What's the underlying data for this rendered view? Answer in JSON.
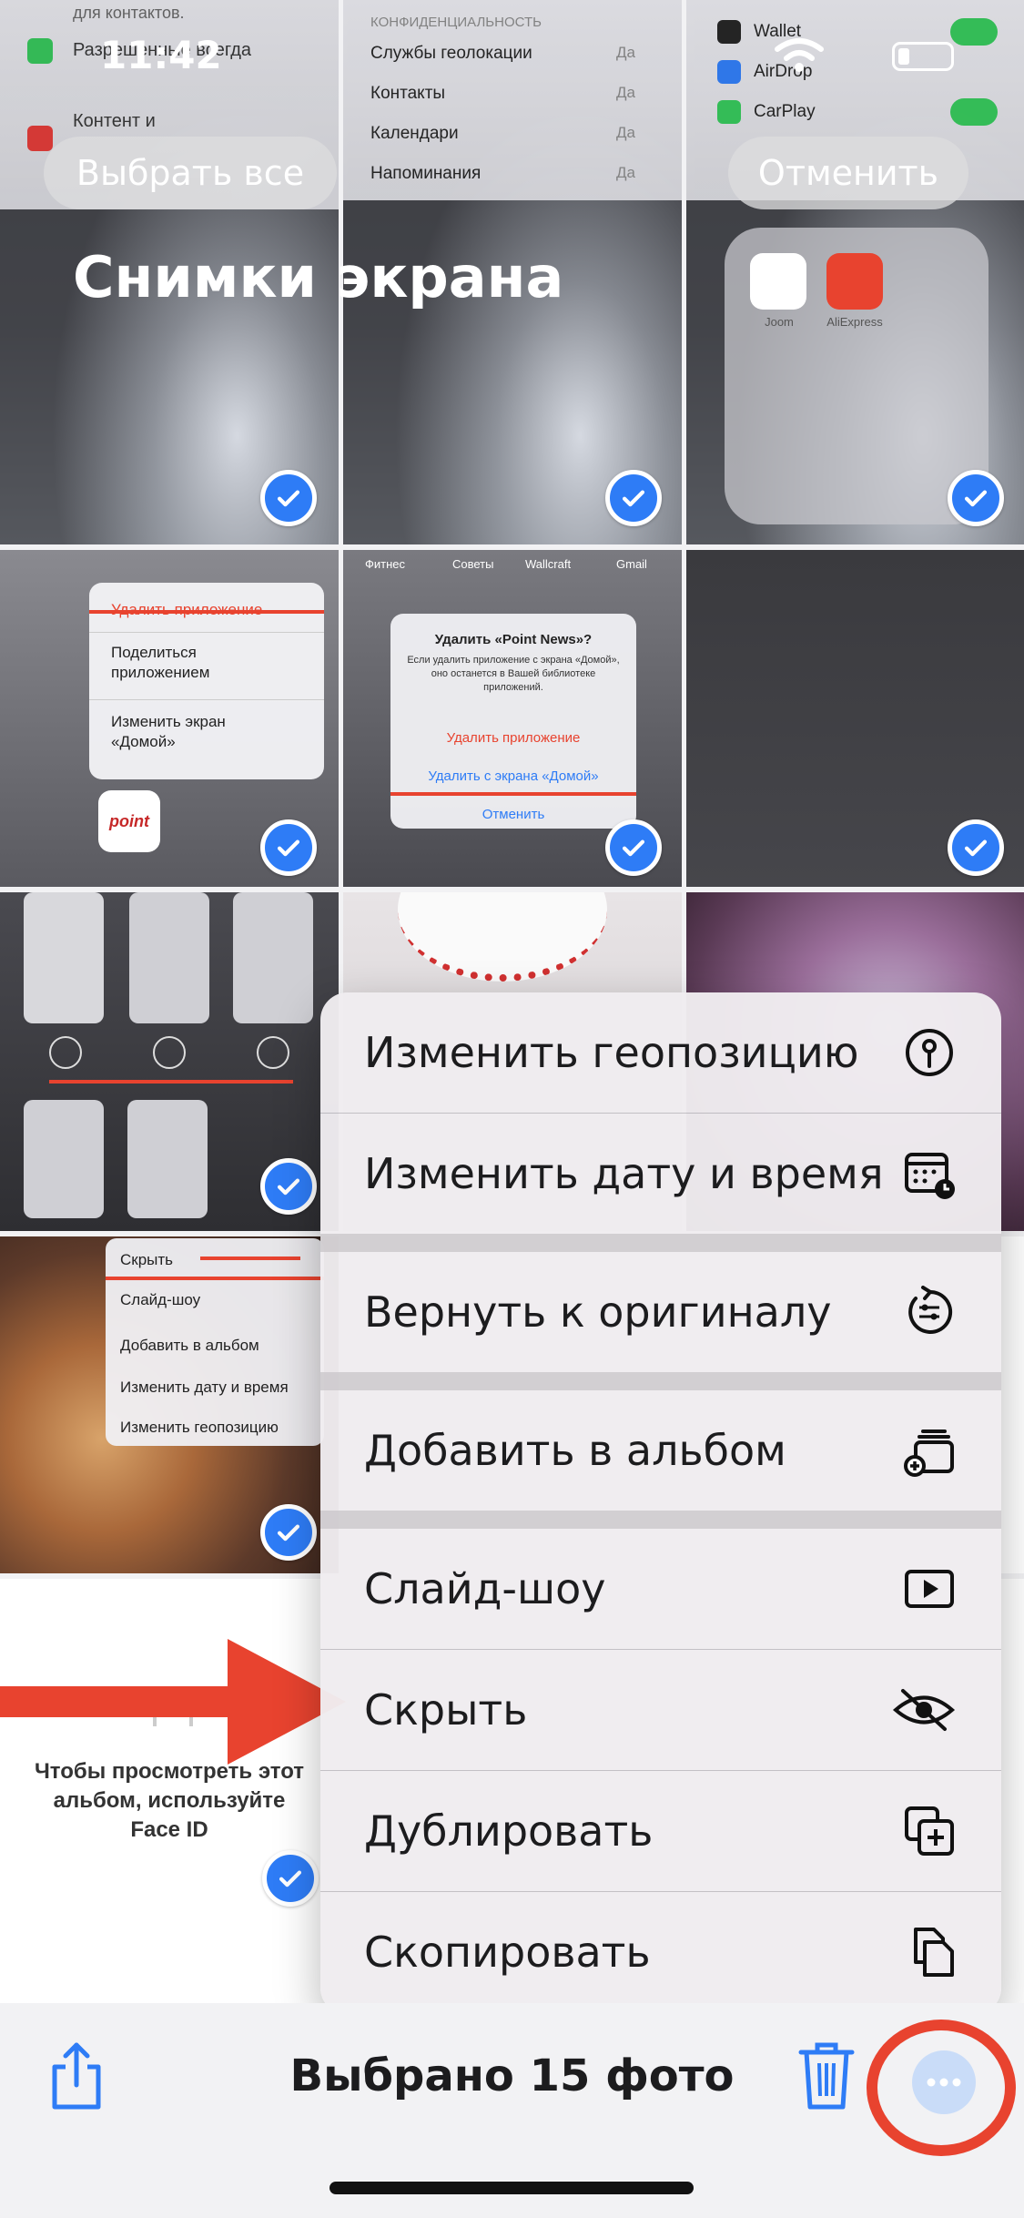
{
  "status_bar": {
    "time": "11:42"
  },
  "header": {
    "select_all_label": "Выбрать все",
    "cancel_label": "Отменить",
    "album_title": "Снимки экрана"
  },
  "thumbnails": {
    "settings_top_left": {
      "lines": [
        "для контактов.",
        "Разрешенные всегда",
        "Контент и"
      ]
    },
    "settings_top_mid": {
      "section": "КОНФИДЕНЦИАЛЬНОСТЬ",
      "rows": [
        {
          "label": "Службы геолокации",
          "value": "Да"
        },
        {
          "label": "Контакты",
          "value": "Да"
        },
        {
          "label": "Календари",
          "value": "Да"
        },
        {
          "label": "Напоминания",
          "value": "Да"
        }
      ]
    },
    "settings_top_right": {
      "rows": [
        "Wallet",
        "AirDrop",
        "CarPlay"
      ]
    },
    "folder_apps": [
      "Joom",
      "AliExpress"
    ],
    "app_menu": [
      "Удалить приложение",
      "Поделиться приложением",
      "Изменить экран «Домой»"
    ],
    "app_menu_logo": "point",
    "alert": {
      "top_apps": [
        "Фитнес",
        "Советы",
        "Wallcraft",
        "Gmail"
      ],
      "title": "Удалить «Point News»?",
      "message": "Если удалить приложение с экрана «Домой», оно останется в Вашей библиотеке приложений.",
      "delete_app": "Удалить приложение",
      "remove_home": "Удалить с экрана «Домой»",
      "cancel": "Отменить"
    },
    "photos_menu": [
      "Скрыть",
      "Слайд-шоу",
      "Добавить в альбом",
      "Изменить дату и время",
      "Изменить геопозицию"
    ],
    "locked_album_text": "Чтобы просмотреть этот альбом, используйте Face ID"
  },
  "context_menu": {
    "items": [
      {
        "label": "Изменить геопозицию",
        "icon": "location-pin-icon"
      },
      {
        "label": "Изменить дату и время",
        "icon": "calendar-clock-icon"
      },
      {
        "label": "Вернуть к оригиналу",
        "icon": "revert-icon"
      },
      {
        "label": "Добавить в альбом",
        "icon": "add-to-album-icon"
      },
      {
        "label": "Слайд-шоу",
        "icon": "play-icon"
      },
      {
        "label": "Скрыть",
        "icon": "eye-slash-icon"
      },
      {
        "label": "Дублировать",
        "icon": "duplicate-icon"
      },
      {
        "label": "Скопировать",
        "icon": "copy-icon"
      }
    ]
  },
  "toolbar": {
    "selection_label": "Выбрано 15 фото"
  },
  "colors": {
    "accent": "#2e7cf6",
    "annotation_red": "#e8432f",
    "menu_bg": "#f0ecf0"
  }
}
